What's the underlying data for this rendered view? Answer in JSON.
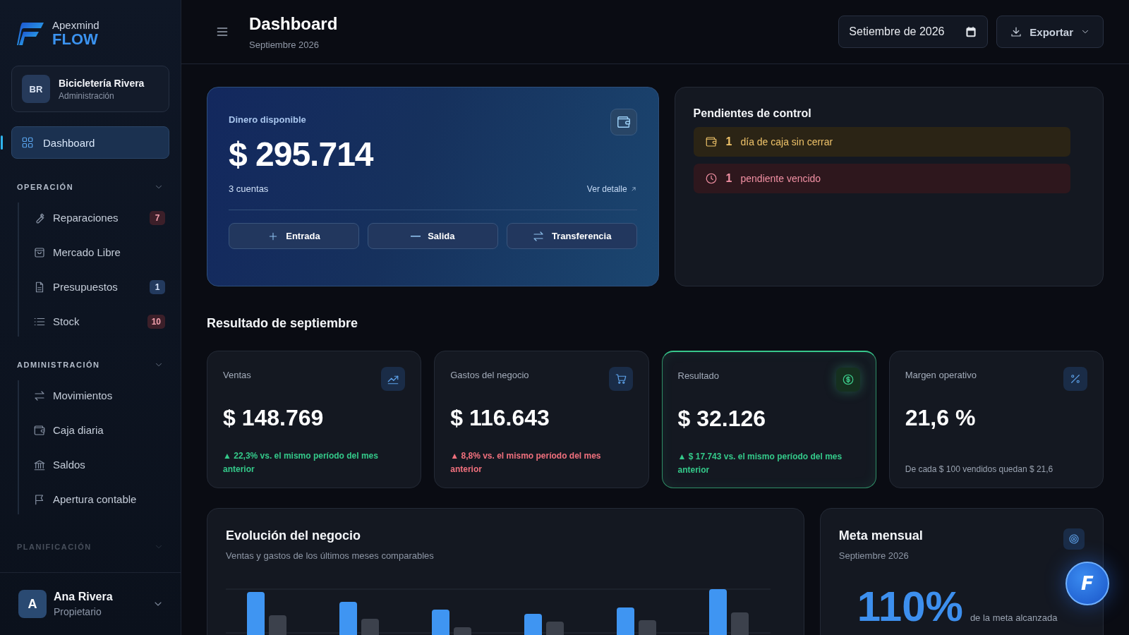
{
  "brand": {
    "name": "Apexmind",
    "product": "FLOW"
  },
  "business": {
    "initials": "BR",
    "name": "Bicicletería Rivera",
    "role": "Administración"
  },
  "nav": [
    {
      "label": "Dashboard",
      "selected": true
    }
  ],
  "sections": [
    {
      "title": "OPERACIÓN",
      "items": [
        {
          "label": "Reparaciones",
          "selected": false,
          "badge": {
            "text": "7",
            "kind": "danger"
          }
        },
        {
          "label": "Mercado Libre",
          "selected": false
        },
        {
          "label": "Presupuestos",
          "selected": false,
          "badge": {
            "text": "1",
            "kind": "info"
          }
        },
        {
          "label": "Stock",
          "selected": false,
          "badge": {
            "text": "10",
            "kind": "danger"
          }
        }
      ]
    },
    {
      "title": "ADMINISTRACIÓN",
      "items": [
        {
          "label": "Movimientos",
          "selected": false
        },
        {
          "label": "Caja diaria",
          "selected": false
        },
        {
          "label": "Saldos",
          "selected": false
        },
        {
          "label": "Apertura contable",
          "selected": false
        }
      ]
    },
    {
      "title": "PLANIFICACIÓN"
    }
  ],
  "user": {
    "initial": "A",
    "name": "Ana Rivera",
    "role": "Propietario"
  },
  "header": {
    "title": "Dashboard",
    "subtitle": "Septiembre 2026",
    "date_field": {
      "value": "Setiembre de 2026"
    },
    "export_button": "Exportar"
  },
  "money_card": {
    "label": "Dinero disponible",
    "amount": "$ 295.714",
    "accounts": "3 cuentas",
    "link": "Ver detalle",
    "actions": [
      "Entrada",
      "Salida",
      "Transferencia"
    ]
  },
  "pending": {
    "title": "Pendientes de control",
    "items": [
      {
        "kind": "warning",
        "count": "1",
        "text": "día de caja sin cerrar"
      },
      {
        "kind": "danger",
        "count": "1",
        "text": "pendiente vencido"
      }
    ]
  },
  "results": {
    "title": "Resultado de septiembre",
    "cards": [
      {
        "label": "Ventas",
        "value": "$ 148.769",
        "highlighted": false,
        "note": {
          "kind": "positive",
          "text": "▲ 22,3% vs. el mismo período del mes anterior"
        }
      },
      {
        "label": "Gastos del negocio",
        "value": "$ 116.643",
        "highlighted": false,
        "note": {
          "kind": "negative",
          "text": "▲ 8,8% vs. el mismo período del mes anterior"
        }
      },
      {
        "label": "Resultado",
        "value": "$ 32.126",
        "highlighted": true,
        "note": {
          "kind": "positive",
          "text": "▲ $ 17.743 vs. el mismo período del mes anterior"
        }
      },
      {
        "label": "Margen operativo",
        "value": "21,6 %",
        "highlighted": false,
        "note": {
          "kind": "neutral",
          "text": "De cada $ 100 vendidos quedan $ 21,6"
        }
      }
    ]
  },
  "evolution": {
    "title": "Evolución del negocio",
    "subtitle": "Ventas y gastos de los últimos meses comparables"
  },
  "goal": {
    "title": "Meta mensual",
    "subtitle": "Septiembre 2026",
    "percent": "110%",
    "caption": "de la meta alcanzada"
  },
  "assistant_button": {
    "label": "F"
  }
}
